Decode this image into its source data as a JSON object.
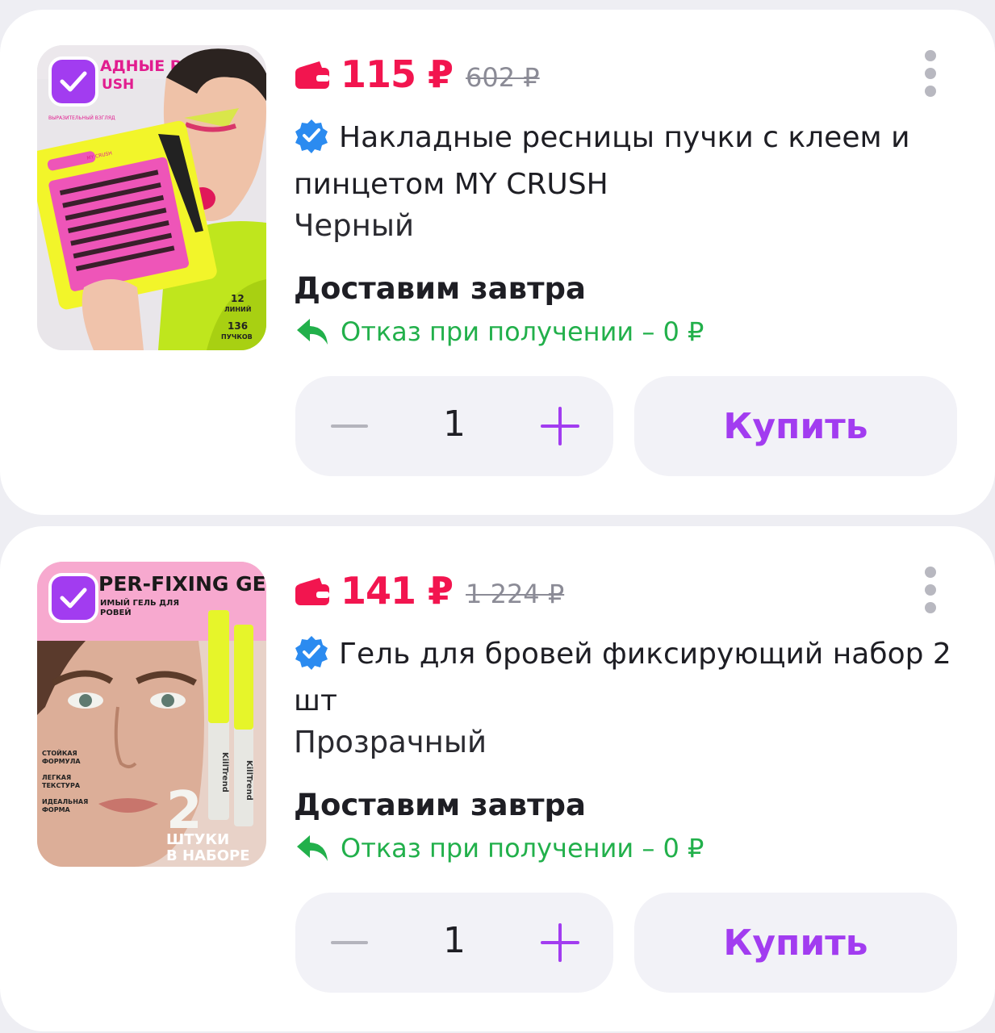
{
  "colors": {
    "price": "#f2154f",
    "accent": "#a23cf0",
    "refund": "#22b04b",
    "verified": "#2b8bf0"
  },
  "products": [
    {
      "price": "115 ₽",
      "old_price": "602 ₽",
      "title": "Накладные ресницы пучки с клеем и пинцетом MY CRUSH",
      "variant": "Черный",
      "delivery": "Доставим завтра",
      "refund": "Отказ при получении – 0 ₽",
      "quantity": "1",
      "buy_label": "Купить",
      "image_banner": "АДНЫЕ РЕСНИЦЫ",
      "image_brand": "USH",
      "image_small": "ВЫРАЗИТЕЛЬНЫЙ ВЗГЛЯД",
      "image_count1": "12",
      "image_count1_label": "ЛИНИЙ",
      "image_count2": "136",
      "image_count2_label": "ПУЧКОВ",
      "image_tube": "MY CRUSH"
    },
    {
      "price": "141 ₽",
      "old_price": "1 224 ₽",
      "title": "Гель для бровей фиксирующий набор 2 шт",
      "variant": "Прозрачный",
      "delivery": "Доставим завтра",
      "refund": "Отказ при получении – 0 ₽",
      "quantity": "1",
      "buy_label": "Купить",
      "image_banner": "PER-FIXING GEL",
      "image_sub1": "ИМЫЙ ГЕЛЬ ДЛЯ",
      "image_sub2": "РОВЕЙ",
      "image_feat1": "СТОЙКАЯ",
      "image_feat1b": "ФОРМУЛА",
      "image_feat2": "ЛЕГКАЯ",
      "image_feat2b": "ТЕКСТУРА",
      "image_feat3": "ИДЕАЛЬНАЯ",
      "image_feat3b": "ФОРМА",
      "image_big": "2",
      "image_caption1": "ШТУКИ",
      "image_caption2": "В НАБОРЕ",
      "image_tube_brand": "KillTrend"
    }
  ]
}
